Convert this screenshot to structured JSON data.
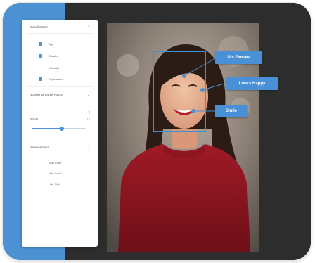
{
  "panel": {
    "classification": {
      "title": "Classification",
      "items": [
        {
          "label": "Age",
          "checked": true
        },
        {
          "label": "Gender",
          "checked": true
        },
        {
          "label": "Ethnicity",
          "checked": false
        },
        {
          "label": "Expression",
          "checked": true
        }
      ]
    },
    "facial_points": {
      "title": "Number of Facial Points",
      "value": "0"
    },
    "points": {
      "title": "Points",
      "count": "13",
      "slider_level": 0.55
    },
    "measurement": {
      "title": "Measurement",
      "items": [
        {
          "label": "Skin Color"
        },
        {
          "label": "Hair Color"
        },
        {
          "label": "Hair Style"
        }
      ]
    }
  },
  "annotations": {
    "tags": [
      "20s Female",
      "Looks Happy",
      "Smile"
    ]
  },
  "colors": {
    "accent": "#4c92d2",
    "dark_bg": "#2d2d2d",
    "tag_bg": "#4a90d6",
    "shirt": "#8b1420"
  }
}
